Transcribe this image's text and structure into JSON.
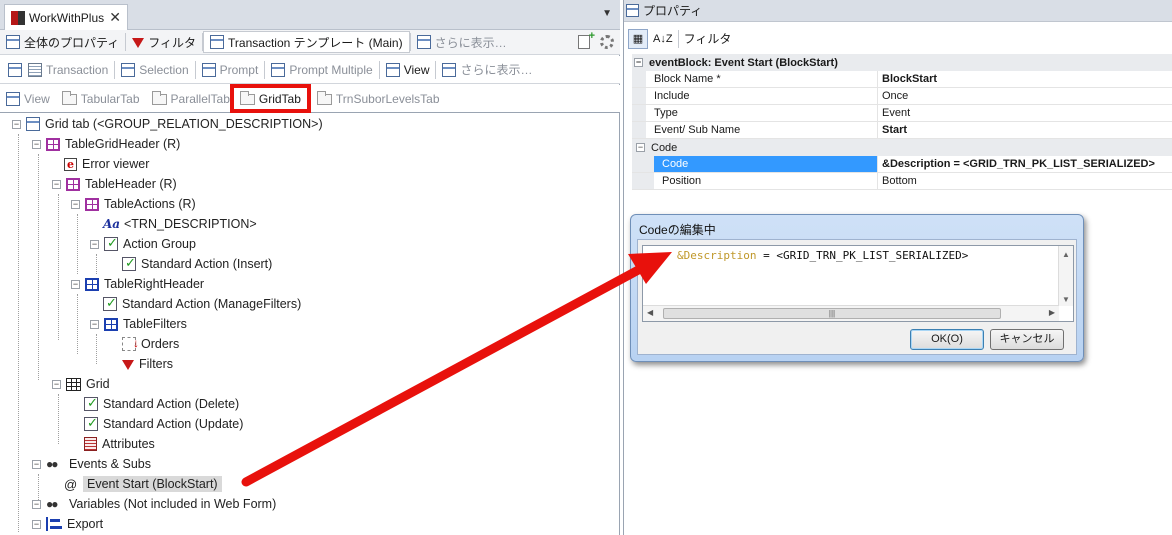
{
  "left": {
    "doc_tab": {
      "title": "WorkWithPlus",
      "close": "✕"
    },
    "panel_menu": "▼",
    "toolbar1": {
      "all_properties": "全体のプロパティ",
      "filter": "フィルタ",
      "template": "Transaction テンプレート (Main)",
      "more": "さらに表示…"
    },
    "toolbar2": {
      "items": [
        "Transaction",
        "Selection",
        "Prompt",
        "Prompt Multiple",
        "View"
      ],
      "more": "さらに表示…"
    },
    "toolbar3": {
      "tabs": [
        "View",
        "TabularTab",
        "ParallelTab",
        "GridTab",
        "TrnSuborLevelsTab"
      ]
    },
    "tree": {
      "root": "Grid tab (<GROUP_RELATION_DESCRIPTION>)",
      "table_grid_header": "TableGridHeader (R)",
      "error_viewer": "Error viewer",
      "table_header": "TableHeader (R)",
      "table_actions": "TableActions (R)",
      "trn_description": "<TRN_DESCRIPTION>",
      "action_group": "Action Group",
      "std_insert": "Standard Action (Insert)",
      "table_right_header": "TableRightHeader",
      "std_managefilters": "Standard Action (ManageFilters)",
      "table_filters": "TableFilters",
      "orders": "Orders",
      "filters": "Filters",
      "grid": "Grid",
      "std_delete": "Standard Action (Delete)",
      "std_update": "Standard Action (Update)",
      "attributes": "Attributes",
      "events_subs": "Events & Subs",
      "event_start": "Event Start (BlockStart)",
      "variables": "Variables (Not included in Web Form)",
      "export": "Export"
    }
  },
  "right": {
    "title": "プロパティ",
    "toolbar": {
      "sort_az": "A↓Z",
      "filter": "フィルタ"
    },
    "category_event": "eventBlock: Event Start (BlockStart)",
    "rows": [
      {
        "name": "Block Name *",
        "value": "BlockStart",
        "bold": true
      },
      {
        "name": "Include",
        "value": "Once",
        "bold": false
      },
      {
        "name": "Type",
        "value": "Event",
        "bold": false
      },
      {
        "name": "Event/ Sub Name",
        "value": "Start",
        "bold": true
      }
    ],
    "category_code": "Code",
    "code_rows": [
      {
        "name": "Code",
        "value": "&Description = <GRID_TRN_PK_LIST_SERIALIZED>"
      },
      {
        "name": "Position",
        "value": "Bottom"
      }
    ]
  },
  "dialog": {
    "title": "Codeの編集中",
    "code_var": "&Description",
    "code_rest": " = <GRID_TRN_PK_LIST_SERIALIZED>",
    "ok": "OK(O)",
    "cancel": "キャンセル"
  },
  "colors": {
    "highlight_box": "#e8110c",
    "arrow": "#e8110c",
    "selection": "#3399ff"
  }
}
